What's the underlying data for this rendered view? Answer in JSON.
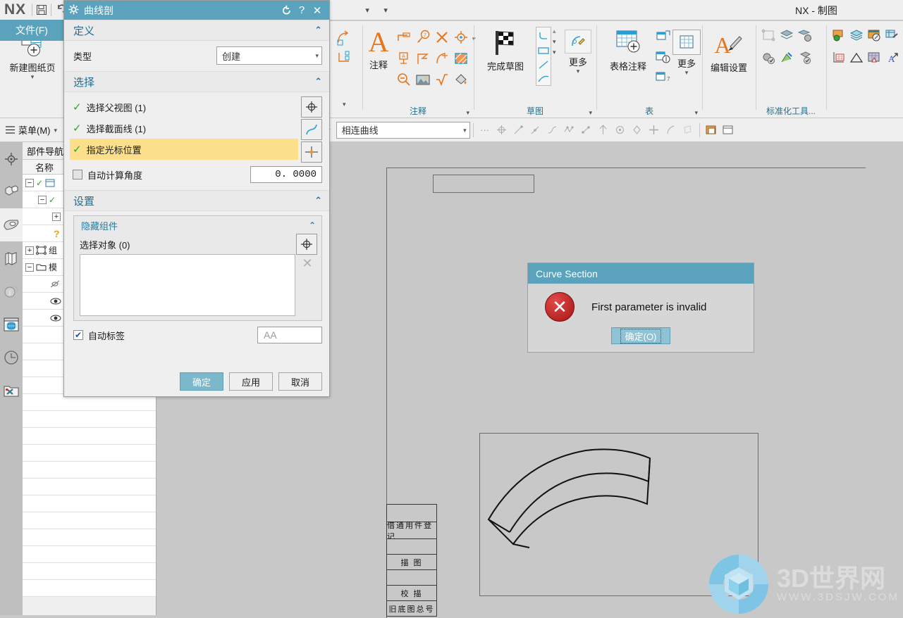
{
  "titlebar": {
    "logo": "NX",
    "window_title": "NX - 制图",
    "save_icon": "save-icon",
    "undo_icon": "undo-icon",
    "redo_icon": "redo-icon",
    "customize_icon": "customize-dropdown-icon"
  },
  "file_tab": {
    "label": "文件(F)"
  },
  "ribbon": {
    "new_sheet": {
      "label": "新建图纸页",
      "icon": "new-drawing-sheet-icon"
    },
    "groups": [
      {
        "name": "注释",
        "label": "注释"
      },
      {
        "name": "草图",
        "label": "草图"
      },
      {
        "name": "表",
        "label": "表"
      },
      {
        "name": "标准化工具",
        "label": "标准化工具..."
      }
    ],
    "annotation_big": {
      "label": "注释",
      "icon": "annotation-A-icon"
    },
    "finish_sketch": {
      "label": "完成草图",
      "icon": "checkered-flag-icon"
    },
    "sketch_more": {
      "label": "更多",
      "icon": "sketch-more-icon"
    },
    "table_note": {
      "label": "表格注释",
      "icon": "table-plus-icon"
    },
    "table_more": {
      "label": "更多",
      "icon": "table-grid-icon"
    },
    "edit_settings": {
      "label": "编辑设置",
      "icon": "edit-settings-A-brush-icon"
    },
    "annotation_icons": [
      "dimension-linear-icon",
      "balloon-7-icon",
      "cross-symbol-icon",
      "center-mark-icon",
      "annotation-dropdown-icon",
      "surface-finish-icon",
      "flag-note-icon",
      "weld-symbol-icon",
      "section-hatch-icon",
      "zoom-out-icon",
      "image-icon",
      "radical-icon",
      "paint-drop-icon"
    ]
  },
  "toolbar2": {
    "menu": {
      "label": "菜单(M)",
      "icon": "hamburger-menu-icon"
    },
    "curve_rule": {
      "value": "相连曲线",
      "icon": "chevron-down-icon"
    },
    "filter_icons": [
      "solid-body-filter-icon",
      "filter-funnel-icon",
      "selection-scope-icon",
      "feature-select-icon",
      "face-select-icon",
      "body-select-icon",
      "point-select-icon"
    ],
    "snap_icons": [
      "more-ellipsis-icon",
      "snap-all-icon",
      "snap-endpoint-icon",
      "snap-midpoint-icon",
      "snap-control-point-icon",
      "snap-intersection-icon",
      "snap-arc-center-icon",
      "snap-quadrant-icon",
      "snap-point-icon",
      "snap-tangent-icon",
      "snap-existing-point-icon",
      "snap-face-icon"
    ]
  },
  "resource_bar": {
    "items": [
      {
        "name": "assembly-navigator",
        "icon": "assembly-navigator-icon",
        "selected": false
      },
      {
        "name": "constraint-navigator",
        "icon": "constraint-navigator-icon",
        "selected": false
      },
      {
        "name": "part-navigator",
        "icon": "part-navigator-icon",
        "selected": true
      },
      {
        "name": "reuse-library",
        "icon": "reuse-library-icon",
        "selected": false
      },
      {
        "name": "hd3d-tools",
        "icon": "hd3d-info-icon",
        "selected": false
      },
      {
        "name": "web-browser",
        "icon": "web-browser-globe-icon",
        "selected": false
      },
      {
        "name": "history",
        "icon": "history-clock-icon",
        "selected": false
      },
      {
        "name": "system-materials",
        "icon": "system-tools-icon",
        "selected": false
      }
    ]
  },
  "navigator": {
    "title": "部件导航器",
    "column_header": "名称",
    "rows": [
      {
        "expander": "-",
        "check": "✓",
        "icon": "drawing-sheet-icon",
        "label": ""
      },
      {
        "expander": "-",
        "check": "✓",
        "icon": "view-icon",
        "label": ""
      },
      {
        "expander": "+",
        "check": "",
        "icon": "",
        "label": ""
      },
      {
        "expander": "",
        "check": "",
        "icon": "question-icon",
        "label": ""
      },
      {
        "expander": "+",
        "check": "",
        "icon": "component-box-icon",
        "label": "组"
      },
      {
        "expander": "-",
        "check": "",
        "icon": "folder-icon",
        "label": "模"
      },
      {
        "expander": "",
        "check": "",
        "icon": "datum-icon",
        "label": ""
      },
      {
        "expander": "",
        "check": "",
        "icon": "eye-icon",
        "label": ""
      },
      {
        "expander": "",
        "check": "",
        "icon": "eye-icon",
        "label": ""
      }
    ]
  },
  "dialog": {
    "title": "曲线剖",
    "gear_icon": "gear-icon",
    "reset_icon": "reset-icon",
    "help_icon": "help-icon",
    "close_icon": "close-icon",
    "section_definition": {
      "title": "定义",
      "collapse_icon": "chevron-up-icon"
    },
    "type_label": "类型",
    "type_value": "创建",
    "section_selection": {
      "title": "选择",
      "collapse_icon": "chevron-up-icon"
    },
    "select_rows": [
      {
        "label": "选择父视图 (1)",
        "check": "✓",
        "button_icon": "point-constructor-icon",
        "highlighted": false
      },
      {
        "label": "选择截面线 (1)",
        "check": "✓",
        "button_icon": "curve-icon",
        "highlighted": false
      },
      {
        "label": "指定光标位置",
        "check": "✓",
        "button_icon": "cursor-location-icon",
        "highlighted": true
      }
    ],
    "auto_angle_label": "自动计算角度",
    "auto_angle_checked": false,
    "angle_value": "0. 0000",
    "section_settings": {
      "title": "设置",
      "collapse_icon": "chevron-up-icon"
    },
    "hidden_components": {
      "title": "隐藏组件",
      "collapse_icon": "chevron-up-icon"
    },
    "select_object_label": "选择对象 (0)",
    "select_object_icon": "point-constructor-icon",
    "clear_icon": "clear-x-icon",
    "auto_label_label": "自动标签",
    "auto_label_checked": true,
    "label_placeholder": "AA",
    "buttons": {
      "ok": "确定",
      "apply": "应用",
      "cancel": "取消"
    }
  },
  "error_dialog": {
    "title": "Curve Section",
    "message": "First parameter is invalid",
    "icon": "error-x-icon",
    "ok_button": "确定(O)"
  },
  "drawing": {
    "title_block_cells": [
      "借通用件登记",
      "",
      "描 图",
      "",
      "校 描",
      "",
      "旧底图总号"
    ]
  },
  "watermark": {
    "text": "3D世界网",
    "url": "WWW.3DSJW.COM",
    "logo_icon": "3dsjw-hexagon-cube-logo"
  },
  "colors": {
    "accent": "#5ba3bd",
    "highlight": "#fcdf8a",
    "orange": "#e8751a",
    "section_title": "#1e6f91"
  }
}
